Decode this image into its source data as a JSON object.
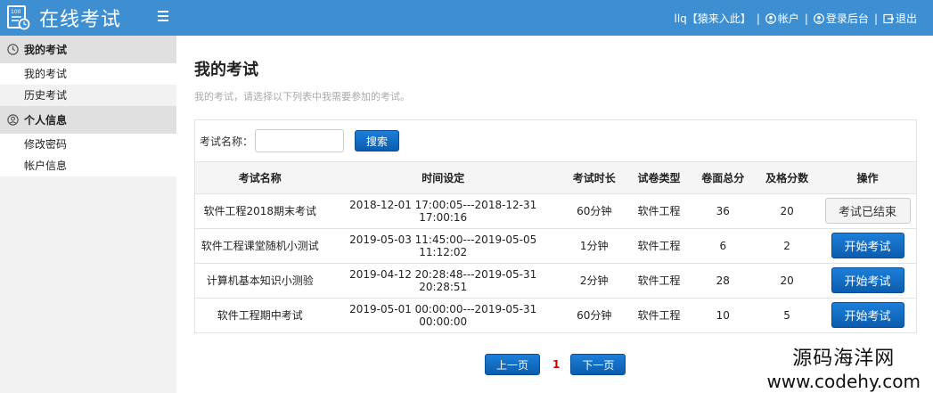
{
  "header": {
    "app_title": "在线考试",
    "user_link": "llq【猿来入此】",
    "account_link": "帐户",
    "admin_link": "登录后台",
    "logout_link": "退出",
    "separator": "|"
  },
  "sidebar": {
    "groups": [
      {
        "title": "我的考试",
        "items": [
          "我的考试",
          "历史考试"
        ]
      },
      {
        "title": "个人信息",
        "items": [
          "修改密码",
          "帐户信息"
        ]
      }
    ]
  },
  "main": {
    "title": "我的考试",
    "description": "我的考试，请选择以下列表中我需要参加的考试。",
    "search": {
      "label": "考试名称：",
      "value": "",
      "placeholder": "",
      "button": "搜索"
    },
    "table": {
      "headers": [
        "考试名称",
        "时间设定",
        "考试时长",
        "试卷类型",
        "卷面总分",
        "及格分数",
        "操作"
      ],
      "rows": [
        {
          "name": "软件工程2018期末考试",
          "time": "2018-12-01 17:00:05---2018-12-31 17:00:16",
          "duration": "60分钟",
          "type": "软件工程",
          "total": "36",
          "pass": "20",
          "action": "考试已结束",
          "ended": true
        },
        {
          "name": "软件工程课堂随机小测试",
          "time": "2019-05-03 11:45:00---2019-05-05 11:12:02",
          "duration": "1分钟",
          "type": "软件工程",
          "total": "6",
          "pass": "2",
          "action": "开始考试",
          "ended": false
        },
        {
          "name": "计算机基本知识小测验",
          "time": "2019-04-12 20:28:48---2019-05-31 20:28:51",
          "duration": "2分钟",
          "type": "软件工程",
          "total": "28",
          "pass": "20",
          "action": "开始考试",
          "ended": false
        },
        {
          "name": "软件工程期中考试",
          "time": "2019-05-01 00:00:00---2019-05-31 00:00:00",
          "duration": "60分钟",
          "type": "软件工程",
          "total": "10",
          "pass": "5",
          "action": "开始考试",
          "ended": false
        }
      ]
    },
    "pager": {
      "prev": "上一页",
      "current": "1",
      "next": "下一页"
    }
  },
  "watermark": {
    "line1": "源码海洋网",
    "line2": "www.codehy.com"
  },
  "colors": {
    "topbar": "#3d8fd1",
    "primary_button": "#0b5cad",
    "current_page": "#cc0000"
  }
}
